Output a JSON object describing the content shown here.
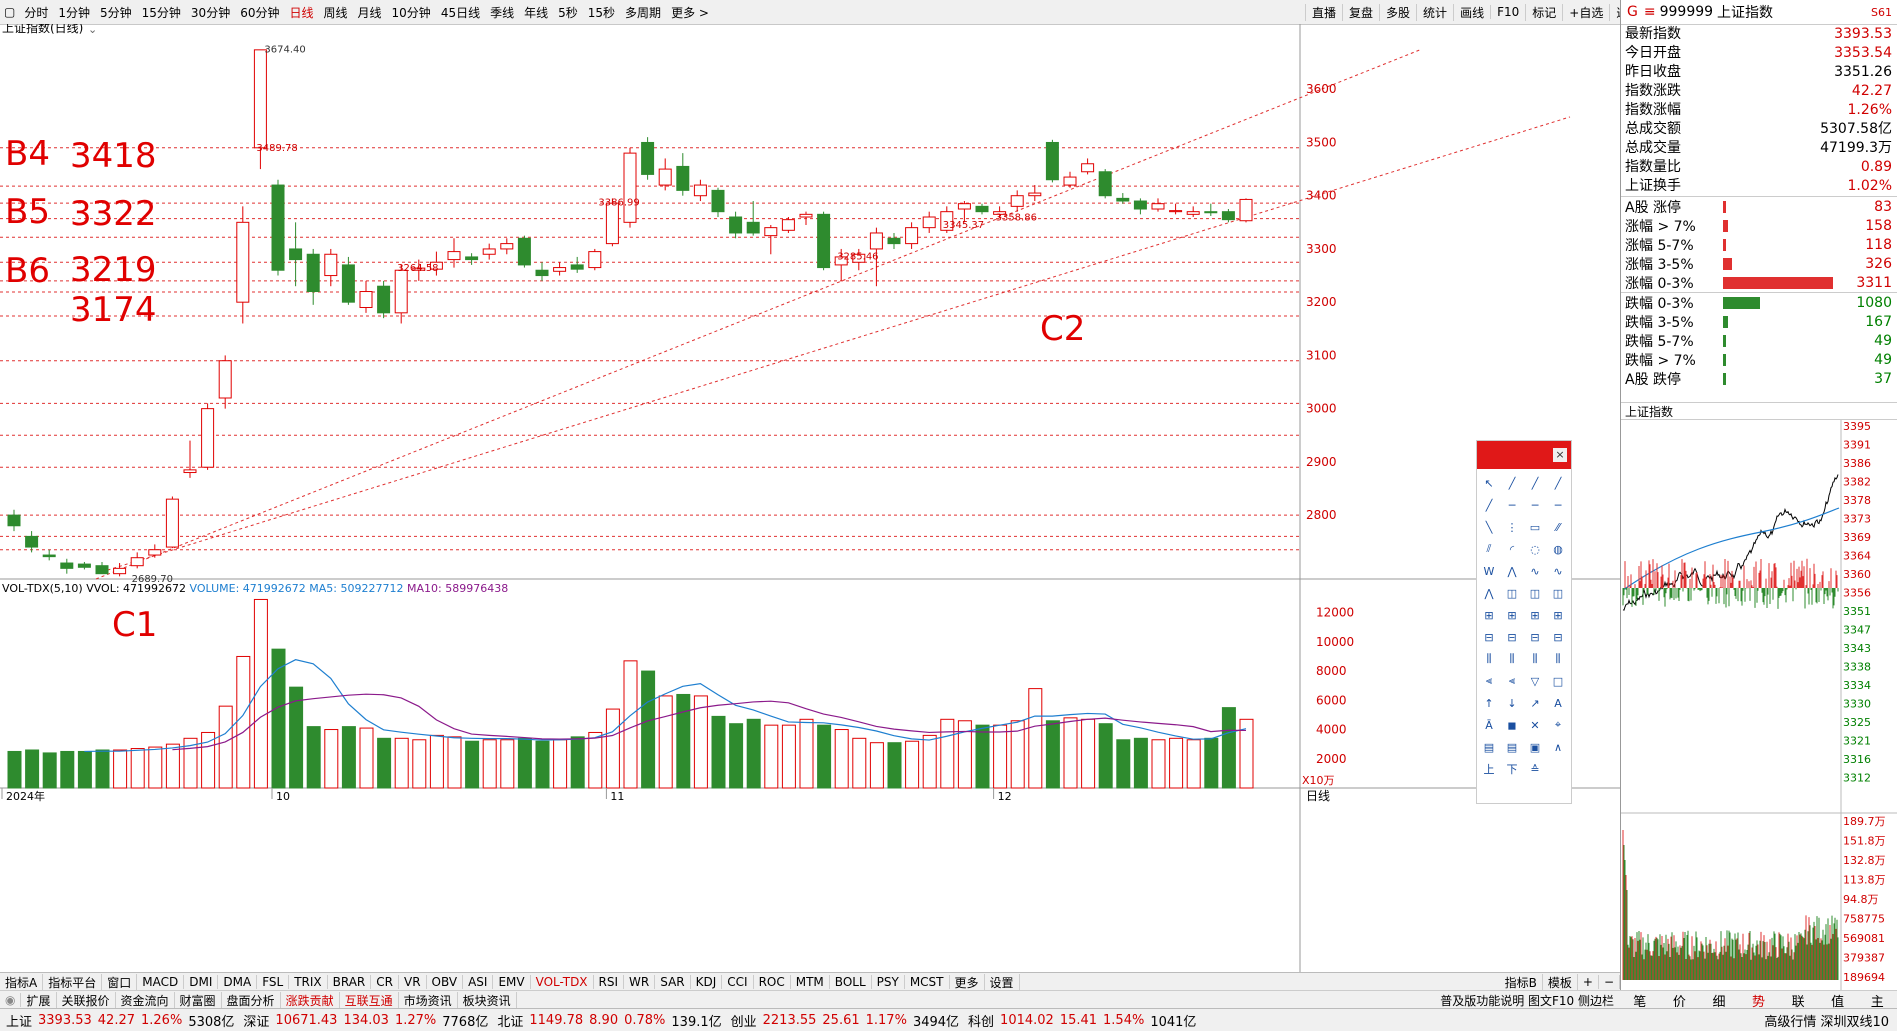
{
  "toolbar": {
    "periods": [
      "分时",
      "1分钟",
      "5分钟",
      "15分钟",
      "30分钟",
      "60分钟",
      "日线",
      "周线",
      "月线",
      "10分钟",
      "45日线",
      "季线",
      "年线",
      "5秒",
      "15秒",
      "多周期",
      "更多 >"
    ],
    "active": "日线",
    "right": [
      "直播",
      "复盘",
      "多股",
      "统计",
      "画线",
      "F10",
      "标记",
      "+自选",
      "返回"
    ]
  },
  "chart": {
    "title": "上证指数(日线)",
    "annotations": {
      "b4": "B4",
      "b4v": "3418",
      "b5": "B5",
      "b5v": "3322",
      "b6": "B6",
      "b6v": "3219",
      "v3174": "3174",
      "c1": "C1",
      "c2": "C2"
    },
    "labels": {
      "high": "3674.40",
      "low": "2689.70",
      "l1": "3489.78",
      "l2": "3386.99",
      "l3": "3264.58",
      "l4": "3285.46",
      "l5": "3358.86",
      "l6": "3345.37"
    },
    "price_axis": [
      "3600",
      "3500",
      "3400",
      "3300",
      "3200",
      "3100",
      "3000",
      "2900",
      "2800"
    ],
    "vol_axis": [
      "12000",
      "10000",
      "8000",
      "6000",
      "4000",
      "2000"
    ],
    "vol_unit": "X10万",
    "date_labels": [
      "2024年",
      "10",
      "11",
      "12"
    ],
    "date_axis_right": "日线"
  },
  "volume_legend": {
    "name": "VOL-TDX(5,10)",
    "vvol": "VVOL: 471992672",
    "volume": "VOLUME: 471992672",
    "ma5": "MA5: 509227712",
    "ma10": "MA10: 589976438"
  },
  "chart_data": {
    "type": "candlestick",
    "title": "上证指数(日线)",
    "candles": [
      {
        "o": 2800,
        "c": 2780,
        "h": 2810,
        "l": 2770
      },
      {
        "o": 2760,
        "c": 2740,
        "h": 2770,
        "l": 2730
      },
      {
        "o": 2725,
        "c": 2722,
        "h": 2735,
        "l": 2715
      },
      {
        "o": 2710,
        "c": 2700,
        "h": 2718,
        "l": 2690
      },
      {
        "o": 2708,
        "c": 2702,
        "h": 2712,
        "l": 2698
      },
      {
        "o": 2705,
        "c": 2690,
        "h": 2712,
        "l": 2689.7
      },
      {
        "o": 2690,
        "c": 2700,
        "h": 2710,
        "l": 2685
      },
      {
        "o": 2705,
        "c": 2720,
        "h": 2730,
        "l": 2700
      },
      {
        "o": 2725,
        "c": 2735,
        "h": 2745,
        "l": 2720
      },
      {
        "o": 2740,
        "c": 2830,
        "h": 2835,
        "l": 2738
      },
      {
        "o": 2880,
        "c": 2885,
        "h": 2940,
        "l": 2870
      },
      {
        "o": 2890,
        "c": 3000,
        "h": 3010,
        "l": 2885
      },
      {
        "o": 3020,
        "c": 3090,
        "h": 3100,
        "l": 3000
      },
      {
        "o": 3200,
        "c": 3350,
        "h": 3380,
        "l": 3160
      },
      {
        "o": 3490,
        "c": 3674,
        "h": 3674.4,
        "l": 3450
      },
      {
        "o": 3420,
        "c": 3260,
        "h": 3430,
        "l": 3250
      },
      {
        "o": 3300,
        "c": 3280,
        "h": 3350,
        "l": 3230
      },
      {
        "o": 3290,
        "c": 3220,
        "h": 3300,
        "l": 3195
      },
      {
        "o": 3250,
        "c": 3290,
        "h": 3300,
        "l": 3230
      },
      {
        "o": 3270,
        "c": 3200,
        "h": 3285,
        "l": 3195
      },
      {
        "o": 3190,
        "c": 3220,
        "h": 3240,
        "l": 3180
      },
      {
        "o": 3230,
        "c": 3180,
        "h": 3240,
        "l": 3170
      },
      {
        "o": 3180,
        "c": 3260,
        "h": 3270,
        "l": 3160
      },
      {
        "o": 3260,
        "c": 3264,
        "h": 3280,
        "l": 3240
      },
      {
        "o": 3262,
        "c": 3275,
        "h": 3295,
        "l": 3250
      },
      {
        "o": 3280,
        "c": 3295,
        "h": 3320,
        "l": 3265
      },
      {
        "o": 3285,
        "c": 3280,
        "h": 3292,
        "l": 3270
      },
      {
        "o": 3290,
        "c": 3300,
        "h": 3310,
        "l": 3280
      },
      {
        "o": 3300,
        "c": 3310,
        "h": 3320,
        "l": 3290
      },
      {
        "o": 3320,
        "c": 3270,
        "h": 3325,
        "l": 3265
      },
      {
        "o": 3260,
        "c": 3250,
        "h": 3275,
        "l": 3240
      },
      {
        "o": 3258,
        "c": 3265,
        "h": 3275,
        "l": 3250
      },
      {
        "o": 3270,
        "c": 3262,
        "h": 3285,
        "l": 3255
      },
      {
        "o": 3265,
        "c": 3295,
        "h": 3300,
        "l": 3260
      },
      {
        "o": 3310,
        "c": 3386,
        "h": 3395,
        "l": 3305
      },
      {
        "o": 3350,
        "c": 3480,
        "h": 3490,
        "l": 3340
      },
      {
        "o": 3500,
        "c": 3440,
        "h": 3510,
        "l": 3430
      },
      {
        "o": 3420,
        "c": 3450,
        "h": 3470,
        "l": 3410
      },
      {
        "o": 3455,
        "c": 3410,
        "h": 3480,
        "l": 3400
      },
      {
        "o": 3400,
        "c": 3420,
        "h": 3430,
        "l": 3390
      },
      {
        "o": 3410,
        "c": 3370,
        "h": 3415,
        "l": 3360
      },
      {
        "o": 3360,
        "c": 3330,
        "h": 3370,
        "l": 3320
      },
      {
        "o": 3350,
        "c": 3330,
        "h": 3390,
        "l": 3325
      },
      {
        "o": 3325,
        "c": 3340,
        "h": 3345,
        "l": 3290
      },
      {
        "o": 3335,
        "c": 3355,
        "h": 3360,
        "l": 3330
      },
      {
        "o": 3360,
        "c": 3365,
        "h": 3370,
        "l": 3345
      },
      {
        "o": 3365,
        "c": 3265,
        "h": 3370,
        "l": 3260
      },
      {
        "o": 3270,
        "c": 3285,
        "h": 3300,
        "l": 3240
      },
      {
        "o": 3275,
        "c": 3290,
        "h": 3300,
        "l": 3260
      },
      {
        "o": 3300,
        "c": 3330,
        "h": 3340,
        "l": 3230
      },
      {
        "o": 3320,
        "c": 3310,
        "h": 3330,
        "l": 3300
      },
      {
        "o": 3310,
        "c": 3340,
        "h": 3350,
        "l": 3300
      },
      {
        "o": 3340,
        "c": 3360,
        "h": 3370,
        "l": 3330
      },
      {
        "o": 3335,
        "c": 3370,
        "h": 3380,
        "l": 3330
      },
      {
        "o": 3375,
        "c": 3385,
        "h": 3390,
        "l": 3350
      },
      {
        "o": 3380,
        "c": 3370,
        "h": 3385,
        "l": 3365
      },
      {
        "o": 3365,
        "c": 3370,
        "h": 3380,
        "l": 3358.86
      },
      {
        "o": 3380,
        "c": 3400,
        "h": 3410,
        "l": 3370
      },
      {
        "o": 3400,
        "c": 3405,
        "h": 3420,
        "l": 3390
      },
      {
        "o": 3500,
        "c": 3430,
        "h": 3505,
        "l": 3425
      },
      {
        "o": 3420,
        "c": 3435,
        "h": 3445,
        "l": 3415
      },
      {
        "o": 3445,
        "c": 3460,
        "h": 3470,
        "l": 3440
      },
      {
        "o": 3445,
        "c": 3400,
        "h": 3450,
        "l": 3395
      },
      {
        "o": 3395,
        "c": 3390,
        "h": 3405,
        "l": 3385
      },
      {
        "o": 3390,
        "c": 3375,
        "h": 3395,
        "l": 3365
      },
      {
        "o": 3375,
        "c": 3385,
        "h": 3395,
        "l": 3370
      },
      {
        "o": 3370,
        "c": 3372,
        "h": 3385,
        "l": 3365
      },
      {
        "o": 3365,
        "c": 3370,
        "h": 3380,
        "l": 3360
      },
      {
        "o": 3370,
        "c": 3368,
        "h": 3385,
        "l": 3362
      },
      {
        "o": 3370,
        "c": 3355,
        "h": 3375,
        "l": 3350
      },
      {
        "o": 3353,
        "c": 3393,
        "h": 3395,
        "l": 3350
      }
    ],
    "volumes": [
      2500,
      2600,
      2400,
      2500,
      2500,
      2600,
      2600,
      2700,
      2800,
      3000,
      3400,
      3800,
      5600,
      9000,
      12900,
      9500,
      6900,
      4200,
      4000,
      4200,
      4100,
      3400,
      3400,
      3300,
      3600,
      3500,
      3200,
      3300,
      3300,
      3400,
      3200,
      3300,
      3500,
      3800,
      5400,
      8700,
      8000,
      6300,
      6400,
      6300,
      4900,
      4400,
      4700,
      4300,
      4300,
      4700,
      4300,
      4000,
      3400,
      3100,
      3100,
      3200,
      3600,
      4700,
      4600,
      4300,
      4300,
      4600,
      6800,
      4600,
      4800,
      4700,
      4400,
      3300,
      3400,
      3300,
      3400,
      3300,
      3400,
      5500,
      4700
    ],
    "price_range": [
      2680,
      3700
    ],
    "horizontal_levels": [
      3490,
      3418,
      3386,
      3357,
      3322,
      3275,
      3240,
      3219,
      3174,
      3090,
      3010,
      2950,
      2890,
      2800,
      2760,
      2735
    ],
    "ma5_color": "#1e7fd0",
    "ma10_color": "#8b1a8b",
    "up_color": "#e00000",
    "down_color": "#2e8b2e"
  },
  "side": {
    "code": "999999",
    "name": "上证指数",
    "badge": "S61",
    "rows": [
      {
        "label": "最新指数",
        "value": "3393.53",
        "color": "r"
      },
      {
        "label": "今日开盘",
        "value": "3353.54",
        "color": "r"
      },
      {
        "label": "昨日收盘",
        "value": "3351.26",
        "color": "k"
      },
      {
        "label": "指数涨跌",
        "value": "42.27",
        "color": "r"
      },
      {
        "label": "指数涨幅",
        "value": "1.26%",
        "color": "r"
      },
      {
        "label": "总成交额",
        "value": "5307.58亿",
        "color": "k"
      },
      {
        "label": "总成交量",
        "value": "47199.3万",
        "color": "k"
      },
      {
        "label": "指数量比",
        "value": "0.89",
        "color": "r"
      },
      {
        "label": "上证换手",
        "value": "1.02%",
        "color": "r"
      }
    ],
    "up_stats": [
      {
        "label": "A股 涨停",
        "value": "83",
        "frac": 0.012
      },
      {
        "label": "涨幅 > 7%",
        "value": "158",
        "frac": 0.02
      },
      {
        "label": "涨幅 5-7%",
        "value": "118",
        "frac": 0.015
      },
      {
        "label": "涨幅 3-5%",
        "value": "326",
        "frac": 0.04
      },
      {
        "label": "涨幅 0-3%",
        "value": "3311",
        "frac": 0.48
      }
    ],
    "down_stats": [
      {
        "label": "跌幅 0-3%",
        "value": "1080",
        "frac": 0.16
      },
      {
        "label": "跌幅 3-5%",
        "value": "167",
        "frac": 0.021
      },
      {
        "label": "跌幅 5-7%",
        "value": "49",
        "frac": 0.007
      },
      {
        "label": "跌幅 > 7%",
        "value": "49",
        "frac": 0.007
      },
      {
        "label": "A股 跌停",
        "value": "37",
        "frac": 0.005
      }
    ],
    "mini_title": "上证指数",
    "mini_price_axis": [
      "3395",
      "3391",
      "3386",
      "3382",
      "3378",
      "3373",
      "3369",
      "3364",
      "3360",
      "3356",
      "3351",
      "3347",
      "3343",
      "3338",
      "3334",
      "3330",
      "3325",
      "3321",
      "3316",
      "3312"
    ],
    "mini_vol_axis": [
      "189.7万",
      "151.8万",
      "132.8万",
      "113.8万",
      "94.8万",
      "758775",
      "569081",
      "379387",
      "189694"
    ],
    "tabs": [
      "笔",
      "价",
      "细",
      "势",
      "联",
      "值",
      "主"
    ],
    "active_tab": "势"
  },
  "indicator_tabs": [
    "指标A",
    "指标平台",
    "窗口",
    "MACD",
    "DMI",
    "DMA",
    "FSL",
    "TRIX",
    "BRAR",
    "CR",
    "VR",
    "OBV",
    "ASI",
    "EMV",
    "VOL-TDX",
    "RSI",
    "WR",
    "SAR",
    "KDJ",
    "CCI",
    "ROC",
    "MTM",
    "BOLL",
    "PSY",
    "MCST",
    "更多",
    "设置"
  ],
  "indicator_active": "VOL-TDX",
  "indicator_right": [
    "指标B",
    "模板"
  ],
  "sub_tabs": [
    "扩展",
    "关联报价",
    "资金流向",
    "财富圈",
    "盘面分析",
    "涨跌贡献",
    "互联互通",
    "市场资讯",
    "板块资讯"
  ],
  "sub_tabs_highlight": [
    "涨跌贡献",
    "互联互通"
  ],
  "sub_right": "普及版功能说明  图文F10  侧边栏",
  "status": {
    "sh_name": "上证",
    "sh_price": "3393.53",
    "sh_chg": "42.27",
    "sh_pct": "1.26%",
    "sh_amt": "5308亿",
    "sz_name": "深证",
    "sz_price": "10671.43",
    "sz_chg": "134.03",
    "sz_pct": "1.27%",
    "sz_amt": "7768亿",
    "bz_name": "北证",
    "bz_price": "1149.78",
    "bz_chg": "8.90",
    "bz_pct": "0.78%",
    "bz_amt": "139.1亿",
    "cy_name": "创业",
    "cy_price": "2213.55",
    "cy_chg": "25.61",
    "cy_pct": "1.17%",
    "cy_amt": "3494亿",
    "kc_name": "科创",
    "kc_price": "1014.02",
    "kc_chg": "15.41",
    "kc_pct": "1.54%",
    "kc_amt": "1041亿",
    "right": "高级行情  深圳双线10"
  }
}
